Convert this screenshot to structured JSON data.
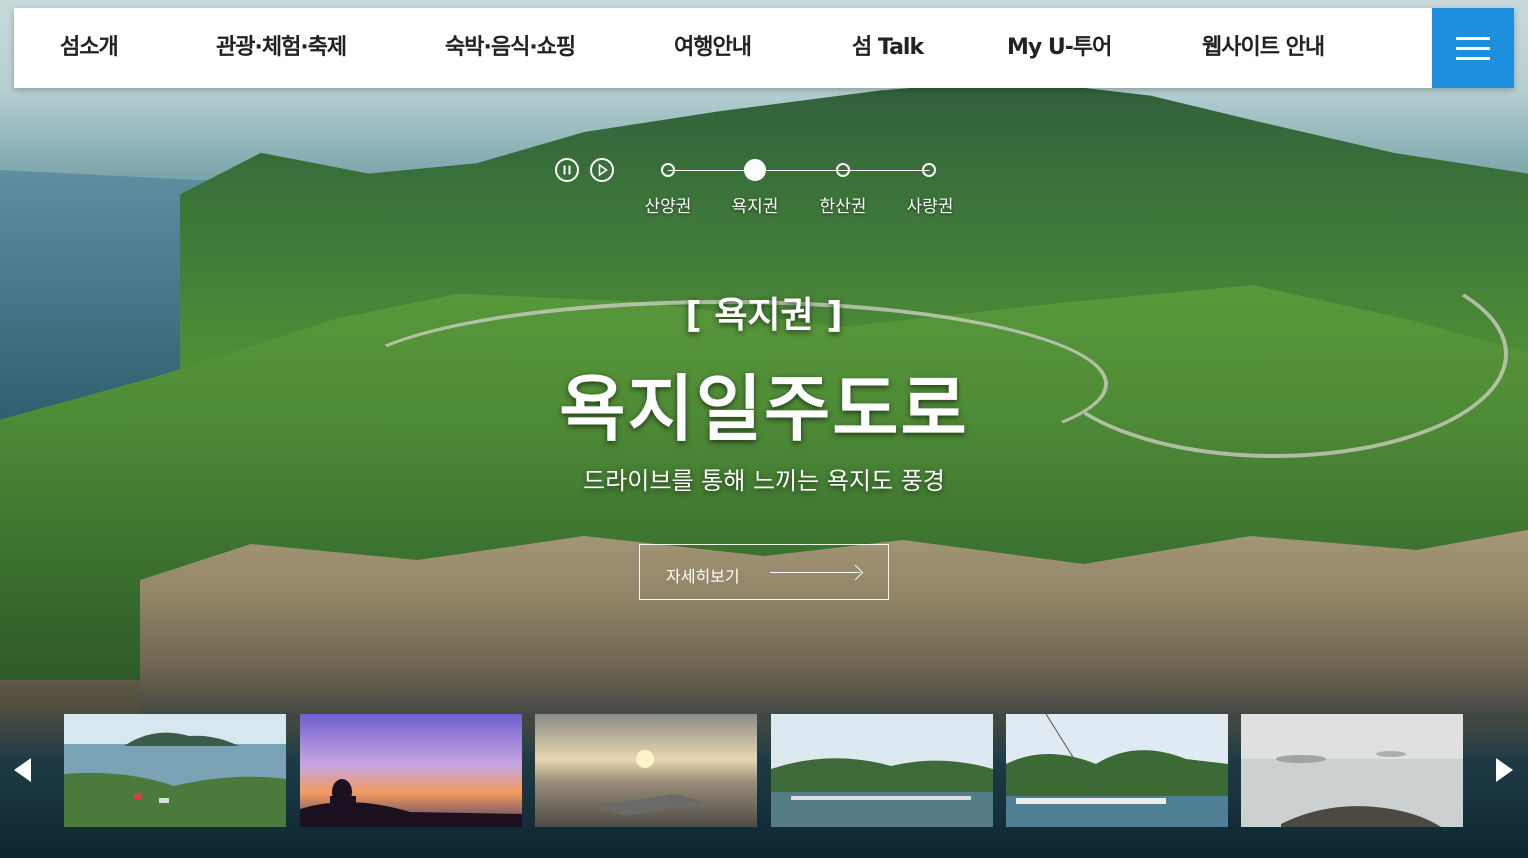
{
  "nav": {
    "items": [
      {
        "label": "섬소개"
      },
      {
        "label": "관광·체험·축제"
      },
      {
        "label": "숙박·음식·쇼핑"
      },
      {
        "label": "여행안내"
      },
      {
        "label": "섬 Talk"
      },
      {
        "label": "My U-투어"
      },
      {
        "label": "웹사이트 안내"
      }
    ],
    "menu_icon": "hamburger-icon",
    "accent_color": "#1e8edf"
  },
  "slider": {
    "controls": {
      "pause_icon": "pause-icon",
      "play_icon": "play-icon"
    },
    "regions": [
      {
        "label": "산양권",
        "active": false
      },
      {
        "label": "욕지권",
        "active": true
      },
      {
        "label": "한산권",
        "active": false
      },
      {
        "label": "사량권",
        "active": false
      }
    ],
    "category": "[ 욕지권 ]",
    "title": "욕지일주도로",
    "subtitle": "드라이브를 통해 느끼는 욕지도 풍경",
    "cta_label": "자세히보기"
  },
  "thumbnails": {
    "prev_icon": "triangle-left-icon",
    "next_icon": "triangle-right-icon",
    "items": [
      {
        "scene": "island-coast"
      },
      {
        "scene": "sunset-silhouette"
      },
      {
        "scene": "sunset-pier"
      },
      {
        "scene": "harbor-village"
      },
      {
        "scene": "village-harbor-bridge"
      },
      {
        "scene": "misty-islands"
      }
    ]
  }
}
